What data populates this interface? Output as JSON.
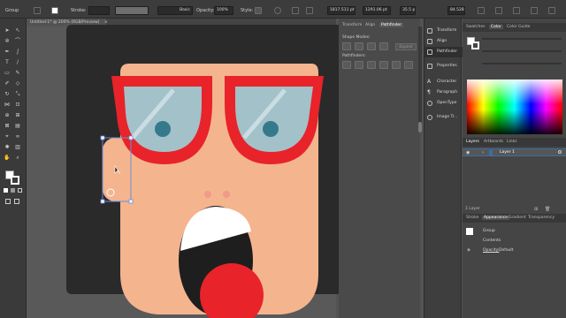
{
  "control_bar": {
    "selection_label": "Group",
    "stroke_label": "Stroke:",
    "stroke_profile": "Basic",
    "opacity_label": "Opacity:",
    "opacity_value": "100%",
    "style_label": "Style:",
    "x_value": "1817.511 pt",
    "y_value": "1291.06 pt",
    "w_value": "35.5 pt",
    "h_value": "84.528 pt"
  },
  "document_tab": {
    "title": "Untitled-1* @ 200% (RGB/Preview)"
  },
  "pathfinder_panel": {
    "tabs": [
      "Transform",
      "Align",
      "Pathfinder"
    ],
    "active_tab": "Pathfinder",
    "shape_modes_label": "Shape Modes:",
    "expand_label": "Expand",
    "pathfinders_label": "Pathfinders:"
  },
  "dock": {
    "items": [
      "Transform",
      "Align",
      "Pathfinder",
      "Properties",
      "Character",
      "Paragraph",
      "OpenType",
      "Image Tr..."
    ]
  },
  "color_panel": {
    "tabs": [
      "Swatches",
      "Color",
      "Color Guide"
    ],
    "active_tab": "Color"
  },
  "layers_panel": {
    "tabs": [
      "Layers",
      "Artboards",
      "Links"
    ],
    "active_tab": "Layers",
    "layer_name": "Layer 1",
    "footer": "1 Layer"
  },
  "appearance_panel": {
    "tabs": [
      "Stroke",
      "Appearance",
      "Gradient",
      "Transparency"
    ],
    "active_tab": "Appearance",
    "object_label": "Group",
    "contents_label": "Contents",
    "opacity_label": "Opacity:",
    "opacity_value": "Default"
  },
  "colors": {
    "skin": "#f4b48e",
    "glasses": "#e8232a",
    "lens": "#a3c1c9",
    "pupil": "#357a8c",
    "artboard": "#2a2a2a",
    "canvas": "#595959",
    "selection": "#6d8fd8",
    "cheek": "#f29a8a"
  }
}
